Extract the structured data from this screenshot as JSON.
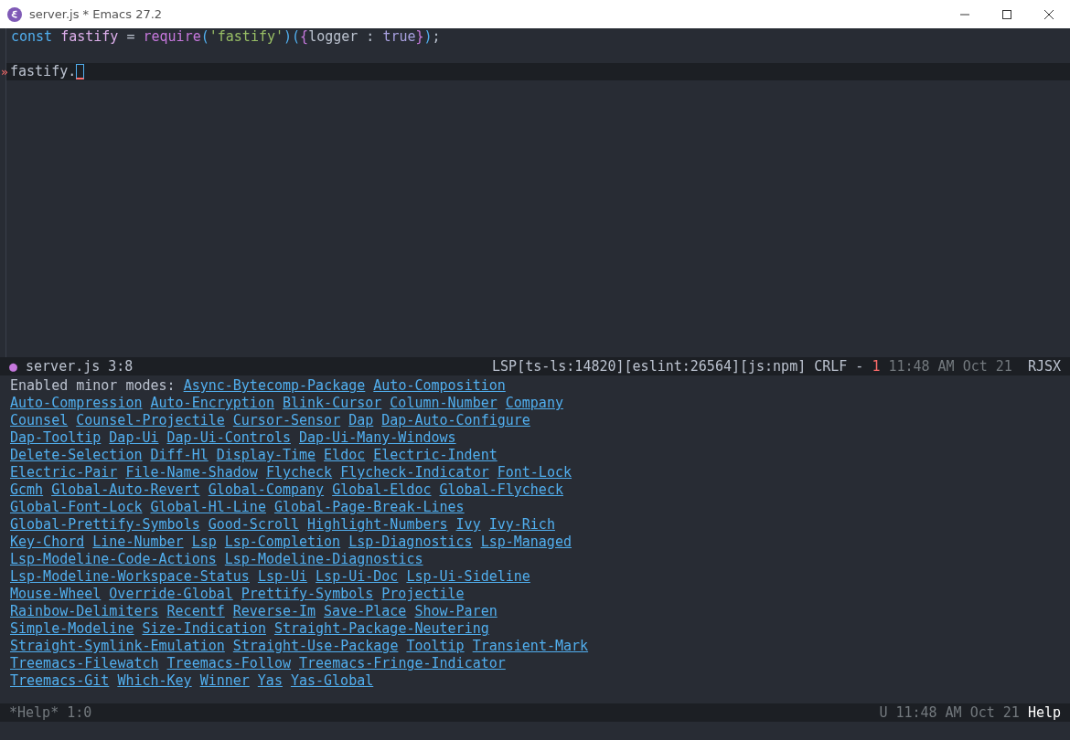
{
  "window": {
    "title": "server.js * Emacs 27.2"
  },
  "editor": {
    "lines": [
      {
        "tokens": [
          {
            "kind": "keyword",
            "text": "const"
          },
          {
            "kind": "variable",
            "text": " fastify"
          },
          {
            "kind": "operator",
            "text": " = "
          },
          {
            "kind": "function",
            "text": "require"
          },
          {
            "kind": "paren",
            "text": "("
          },
          {
            "kind": "string",
            "text": "'fastify'"
          },
          {
            "kind": "paren",
            "text": ")("
          },
          {
            "kind": "brace",
            "text": "{"
          },
          {
            "kind": "plain",
            "text": "logger : "
          },
          {
            "kind": "constant",
            "text": "true"
          },
          {
            "kind": "brace",
            "text": "}"
          },
          {
            "kind": "paren",
            "text": ")"
          },
          {
            "kind": "plain",
            "text": ";"
          }
        ]
      },
      {
        "current": true,
        "marker": "»",
        "tokens": [
          {
            "kind": "plain",
            "text": "fastify."
          }
        ],
        "cursor": true
      }
    ]
  },
  "modeline": {
    "status_dot": "●",
    "buffer": "server.js",
    "position": "3:8",
    "lsp": "LSP[ts-ls:14820][eslint:26564][js:npm]",
    "eol": "CRLF",
    "separator": "-",
    "errors": "1",
    "time": "11:48 AM Oct 21",
    "mode": "RJSX"
  },
  "help": {
    "label": "Enabled minor modes:",
    "lines": [
      [
        "Async-Bytecomp-Package",
        "Auto-Composition"
      ],
      [
        "Auto-Compression",
        "Auto-Encryption",
        "Blink-Cursor",
        "Column-Number",
        "Company"
      ],
      [
        "Counsel",
        "Counsel-Projectile",
        "Cursor-Sensor",
        "Dap",
        "Dap-Auto-Configure"
      ],
      [
        "Dap-Tooltip",
        "Dap-Ui",
        "Dap-Ui-Controls",
        "Dap-Ui-Many-Windows"
      ],
      [
        "Delete-Selection",
        "Diff-Hl",
        "Display-Time",
        "Eldoc",
        "Electric-Indent"
      ],
      [
        "Electric-Pair",
        "File-Name-Shadow",
        "Flycheck",
        "Flycheck-Indicator",
        "Font-Lock"
      ],
      [
        "Gcmh",
        "Global-Auto-Revert",
        "Global-Company",
        "Global-Eldoc",
        "Global-Flycheck"
      ],
      [
        "Global-Font-Lock",
        "Global-Hl-Line",
        "Global-Page-Break-Lines"
      ],
      [
        "Global-Prettify-Symbols",
        "Good-Scroll",
        "Highlight-Numbers",
        "Ivy",
        "Ivy-Rich"
      ],
      [
        "Key-Chord",
        "Line-Number",
        "Lsp",
        "Lsp-Completion",
        "Lsp-Diagnostics",
        "Lsp-Managed"
      ],
      [
        "Lsp-Modeline-Code-Actions",
        "Lsp-Modeline-Diagnostics"
      ],
      [
        "Lsp-Modeline-Workspace-Status",
        "Lsp-Ui",
        "Lsp-Ui-Doc",
        "Lsp-Ui-Sideline"
      ],
      [
        "Mouse-Wheel",
        "Override-Global",
        "Prettify-Symbols",
        "Projectile"
      ],
      [
        "Rainbow-Delimiters",
        "Recentf",
        "Reverse-Im",
        "Save-Place",
        "Show-Paren"
      ],
      [
        "Simple-Modeline",
        "Size-Indication",
        "Straight-Package-Neutering"
      ],
      [
        "Straight-Symlink-Emulation",
        "Straight-Use-Package",
        "Tooltip",
        "Transient-Mark"
      ],
      [
        "Treemacs-Filewatch",
        "Treemacs-Follow",
        "Treemacs-Fringe-Indicator"
      ],
      [
        "Treemacs-Git",
        "Which-Key",
        "Winner",
        "Yas",
        "Yas-Global"
      ]
    ]
  },
  "help_modeline": {
    "buffer": "*Help*",
    "position": "1:0",
    "encoding": "U",
    "time": "11:48 AM Oct 21",
    "mode": "Help"
  }
}
